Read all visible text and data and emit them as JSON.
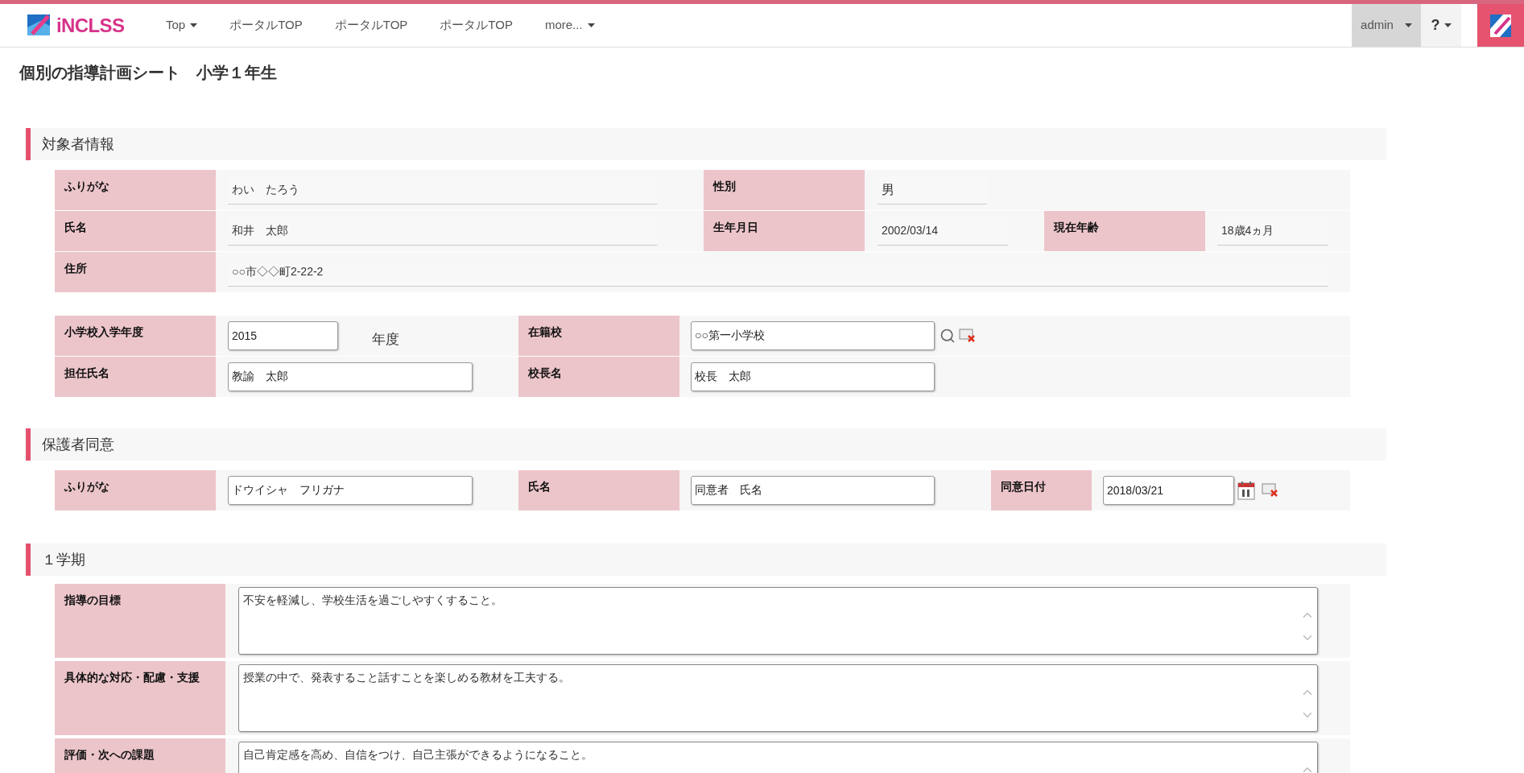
{
  "header": {
    "logo": "iNCLSS",
    "nav": [
      {
        "label": "Top",
        "dropdown": true
      },
      {
        "label": "ポータルTOP",
        "dropdown": false
      },
      {
        "label": "ポータルTOP",
        "dropdown": false
      },
      {
        "label": "ポータルTOP",
        "dropdown": false
      },
      {
        "label": "more...",
        "dropdown": true
      }
    ],
    "user": "admin",
    "help": "?"
  },
  "page_title": "個別の指導計画シート　小学１年生",
  "subject": {
    "title": "対象者情報",
    "furigana": {
      "label": "ふりがな",
      "value": "わい　たろう"
    },
    "gender": {
      "label": "性別",
      "value": "男"
    },
    "name": {
      "label": "氏名",
      "value": "和井　太郎"
    },
    "birth": {
      "label": "生年月日",
      "value": "2002/03/14"
    },
    "age": {
      "label": "現在年齢",
      "value": "18歳4ヵ月"
    },
    "address": {
      "label": "住所",
      "value": "○○市◇◇町2-22-2"
    },
    "entry_year": {
      "label": "小学校入学年度",
      "value": "2015",
      "unit": "年度"
    },
    "school": {
      "label": "在籍校",
      "value": "○○第一小学校"
    },
    "teacher": {
      "label": "担任氏名",
      "value": "教諭　太郎"
    },
    "principal": {
      "label": "校長名",
      "value": "校長　太郎"
    }
  },
  "consent": {
    "title": "保護者同意",
    "furigana": {
      "label": "ふりがな",
      "value": "ドウイシャ　フリガナ"
    },
    "name": {
      "label": "氏名",
      "value": "同意者　氏名"
    },
    "date": {
      "label": "同意日付",
      "value": "2018/03/21"
    }
  },
  "term": {
    "title": "１学期",
    "rows": [
      {
        "label": "指導の目標",
        "value": "不安を軽減し、学校生活を過ごしやすくすること。"
      },
      {
        "label": "具体的な対応・配慮・支援",
        "value": "授業の中で、発表すること話すことを楽しめる教材を工夫する。"
      },
      {
        "label": "評価・次への課題",
        "value": "自己肯定感を高め、自信をつけ、自己主張ができるようになること。"
      }
    ]
  }
}
